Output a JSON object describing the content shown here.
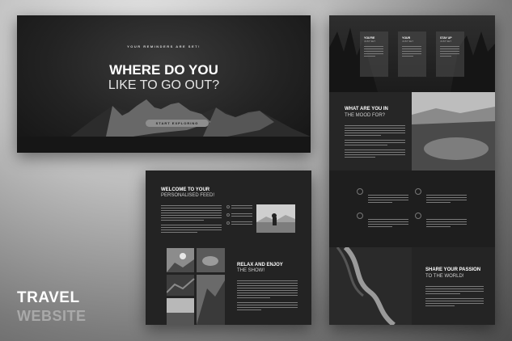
{
  "hero": {
    "eyebrow": "YOUR REMINDERS ARE SET!",
    "title_line1": "WHERE DO YOU",
    "title_line2": "LIKE TO GO OUT?",
    "cta_label": "START EXPLORING"
  },
  "middle": {
    "heading_line1": "WELCOME TO YOUR",
    "heading_line2": "PERSONALISED FEED!",
    "section2_line1": "RELAX AND ENJOY",
    "section2_line2": "THE SHOW!"
  },
  "right": {
    "cards": [
      {
        "title": "YOU'RE",
        "sub": "JUST SET"
      },
      {
        "title": "YOUR",
        "sub": "JUST SET"
      },
      {
        "title": "STAY UP",
        "sub": "JUST SET"
      }
    ],
    "mood_line1": "WHAT ARE YOU IN",
    "mood_line2": "THE MOOD FOR?",
    "share_line1": "SHARE YOUR PASSION",
    "share_line2": "TO THE WORLD!"
  },
  "caption": {
    "line1": "TRAVEL",
    "line2": "WEBSITE"
  },
  "colors": {
    "mockup_bg": "#1d1d1d",
    "accent_gray": "#8e8e8e"
  }
}
